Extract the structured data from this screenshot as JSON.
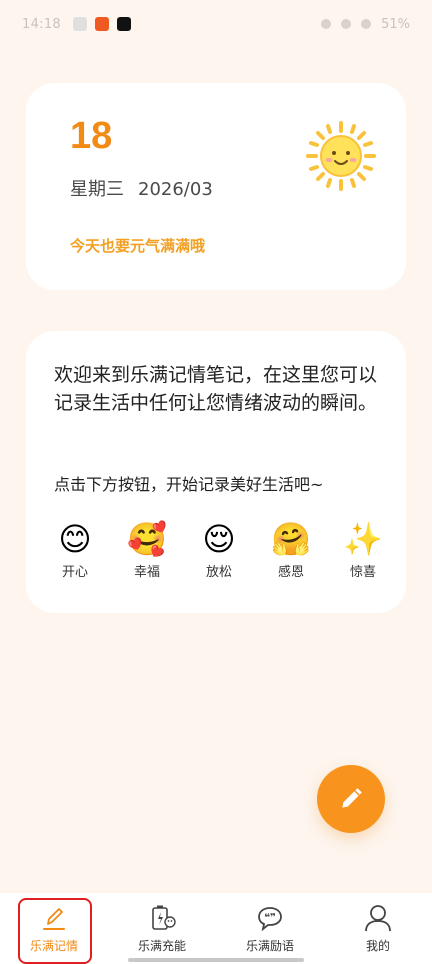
{
  "status_bar": {
    "time": "14:18",
    "battery": "51%"
  },
  "date_card": {
    "day": "18",
    "weekday": "星期三",
    "year_month": "2026/03",
    "greeting": "今天也要元气满满哦",
    "icon": "sun-icon"
  },
  "welcome_card": {
    "intro": "欢迎来到乐满记情笔记，在这里您可以记录生活中任何让您情绪波动的瞬间。",
    "hint": "点击下方按钮，开始记录美好生活吧~",
    "moods": [
      {
        "emoji": "😊",
        "label": "开心"
      },
      {
        "emoji": "🥰",
        "label": "幸福"
      },
      {
        "emoji": "😌",
        "label": "放松"
      },
      {
        "emoji": "🤗",
        "label": "感恩"
      },
      {
        "emoji": "✨",
        "label": "惊喜"
      }
    ]
  },
  "fab": {
    "icon": "pencil-icon"
  },
  "bottom_nav": {
    "items": [
      {
        "label": "乐满记情",
        "icon": "pencil-icon",
        "active": true
      },
      {
        "label": "乐满充能",
        "icon": "battery-icon",
        "active": false
      },
      {
        "label": "乐满励语",
        "icon": "quote-bubble-icon",
        "active": false
      },
      {
        "label": "我的",
        "icon": "person-icon",
        "active": false
      }
    ]
  },
  "colors": {
    "accent": "#F28A16",
    "background": "#FDF5EE",
    "highlight": "#E02020"
  }
}
